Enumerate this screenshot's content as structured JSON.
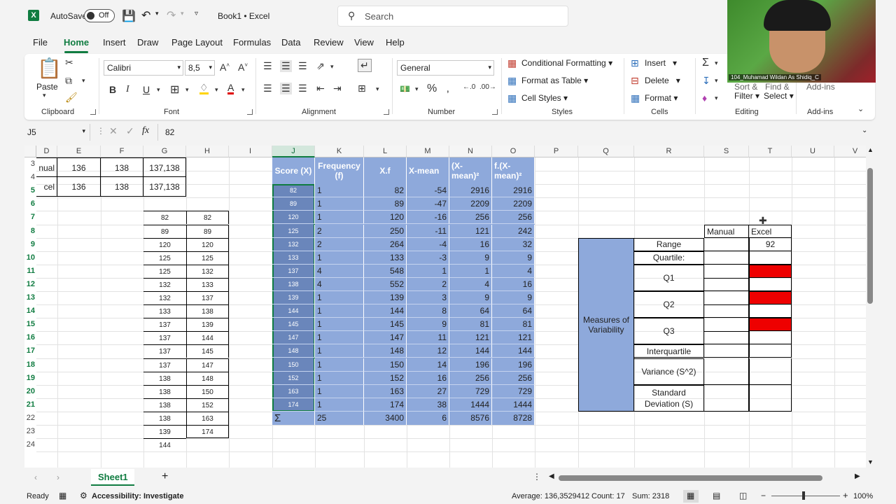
{
  "titlebar": {
    "autosave_label": "AutoSave",
    "autosave_state": "Off",
    "doc_title": "Book1  •  Excel",
    "search_placeholder": "Search"
  },
  "webcam": {
    "label": "104_Muhamad Wildan As Shidiq_C"
  },
  "tabs": [
    "File",
    "Home",
    "Insert",
    "Draw",
    "Page Layout",
    "Formulas",
    "Data",
    "Review",
    "View",
    "Help"
  ],
  "ribbon": {
    "clipboard": {
      "paste": "Paste",
      "label": "Clipboard"
    },
    "font": {
      "name": "Calibri",
      "size": "8,5",
      "label": "Font"
    },
    "alignment": {
      "label": "Alignment"
    },
    "number": {
      "format": "General",
      "label": "Number"
    },
    "styles": {
      "conditional": "Conditional Formatting",
      "table": "Format as Table",
      "cell": "Cell Styles",
      "label": "Styles"
    },
    "cells": {
      "insert": "Insert",
      "delete": "Delete",
      "format": "Format",
      "label": "Cells"
    },
    "editing": {
      "sort": "Sort &",
      "find": "Find &",
      "filter": "Filter",
      "select": "Select",
      "label": "Editing"
    },
    "addins": {
      "label": "Add-ins",
      "top": "Add-ins"
    }
  },
  "formula_bar": {
    "name_box": "J5",
    "value": "82"
  },
  "columns": [
    "D",
    "E",
    "F",
    "G",
    "H",
    "I",
    "J",
    "K",
    "L",
    "M",
    "N",
    "O",
    "P",
    "Q",
    "R",
    "S",
    "T",
    "U",
    "V"
  ],
  "rows": [
    "3",
    "4",
    "5",
    "6",
    "7",
    "8",
    "9",
    "10",
    "11",
    "12",
    "13",
    "14",
    "15",
    "16",
    "17",
    "18",
    "19",
    "20",
    "21",
    "22",
    "23",
    "24"
  ],
  "top_table": {
    "rows": [
      {
        "d": "nual",
        "e": "136",
        "f": "138",
        "g": "137,138"
      },
      {
        "d": "cel",
        "e": "136",
        "f": "138",
        "g": "137,138"
      }
    ]
  },
  "gh_list": {
    "g": [
      "82",
      "89",
      "120",
      "125",
      "125",
      "132",
      "132",
      "133",
      "137",
      "137",
      "137",
      "137",
      "138",
      "138",
      "138",
      "138",
      "139",
      "144"
    ],
    "h": [
      "82",
      "89",
      "120",
      "125",
      "132",
      "133",
      "137",
      "138",
      "139",
      "144",
      "145",
      "147",
      "148",
      "150",
      "152",
      "163",
      "174"
    ]
  },
  "freq_table": {
    "headers": [
      "Score (X)",
      "Frequency (f)",
      "X.f",
      "X-mean",
      "(X-mean)²",
      "f.(X-mean)²"
    ],
    "rows": [
      [
        "82",
        "1",
        "82",
        "-54",
        "2916",
        "2916"
      ],
      [
        "89",
        "1",
        "89",
        "-47",
        "2209",
        "2209"
      ],
      [
        "120",
        "1",
        "120",
        "-16",
        "256",
        "256"
      ],
      [
        "125",
        "2",
        "250",
        "-11",
        "121",
        "242"
      ],
      [
        "132",
        "2",
        "264",
        "-4",
        "16",
        "32"
      ],
      [
        "133",
        "1",
        "133",
        "-3",
        "9",
        "9"
      ],
      [
        "137",
        "4",
        "548",
        "1",
        "1",
        "4"
      ],
      [
        "138",
        "4",
        "552",
        "2",
        "4",
        "16"
      ],
      [
        "139",
        "1",
        "139",
        "3",
        "9",
        "9"
      ],
      [
        "144",
        "1",
        "144",
        "8",
        "64",
        "64"
      ],
      [
        "145",
        "1",
        "145",
        "9",
        "81",
        "81"
      ],
      [
        "147",
        "1",
        "147",
        "11",
        "121",
        "121"
      ],
      [
        "148",
        "1",
        "148",
        "12",
        "144",
        "144"
      ],
      [
        "150",
        "1",
        "150",
        "14",
        "196",
        "196"
      ],
      [
        "152",
        "1",
        "152",
        "16",
        "256",
        "256"
      ],
      [
        "163",
        "1",
        "163",
        "27",
        "729",
        "729"
      ],
      [
        "174",
        "1",
        "174",
        "38",
        "1444",
        "1444"
      ]
    ],
    "totals": [
      "Σ",
      "25",
      "3400",
      "6",
      "8576",
      "8728"
    ]
  },
  "measures": {
    "header_manual": "Manual",
    "header_excel": "Excel",
    "title": "Measures of Variability",
    "range": "Range",
    "range_excel": "92",
    "quartile": "Quartile:",
    "q1": "Q1",
    "q2": "Q2",
    "q3": "Q3",
    "interquartile": "Interquartile",
    "variance": "Variance (S^2)",
    "stddev_1": "Standard",
    "stddev_2": "Deviation (S)",
    "highlight_color": "#ee0000"
  },
  "sheet_tabs": [
    "Sheet1"
  ],
  "status": {
    "ready": "Ready",
    "accessibility": "Accessibility: Investigate",
    "average": "Average: 136,3529412",
    "count": "Count: 17",
    "sum": "Sum: 2318",
    "zoom": "100%"
  },
  "colors": {
    "accent": "#107c41",
    "table_blue": "#8ea9db",
    "selection": "#6a86bb"
  }
}
